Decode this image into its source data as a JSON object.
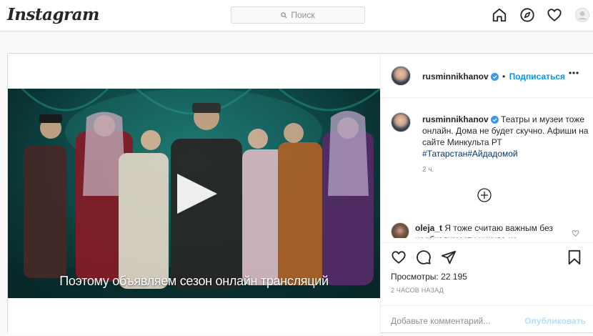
{
  "nav": {
    "logo": "Instagram",
    "search_placeholder": "Поиск",
    "icons": [
      "home-icon",
      "explore-icon",
      "heart-icon",
      "profile-icon"
    ]
  },
  "post": {
    "author": "rusminnikhanov",
    "follow_label": "Подписаться",
    "separator": "•",
    "video_subtitle": "Поэтому объявляем сезон онлайн трансляций",
    "caption": {
      "username": "rusminnikhanov",
      "text": "Театры и музеи тоже онлайн. Дома не будет скучно. Афиши на сайте Минкульта РТ ",
      "hashtags": "#Татарстан#Айдадомой",
      "time": "2 ч."
    },
    "comment": {
      "username": "oleja_t",
      "text": "Я тоже считаю важным без необходимости никуда не"
    },
    "views_label": "Просмотры:",
    "views_count": "22 195",
    "posted": "2 ЧАСОВ НАЗАД",
    "comment_placeholder": "Добавьте комментарий...",
    "publish_label": "Опубликовать"
  },
  "colors": {
    "accent": "#0095f6",
    "hashtag": "#00376b",
    "muted": "#8e8e8e",
    "border": "#dbdbdb"
  }
}
